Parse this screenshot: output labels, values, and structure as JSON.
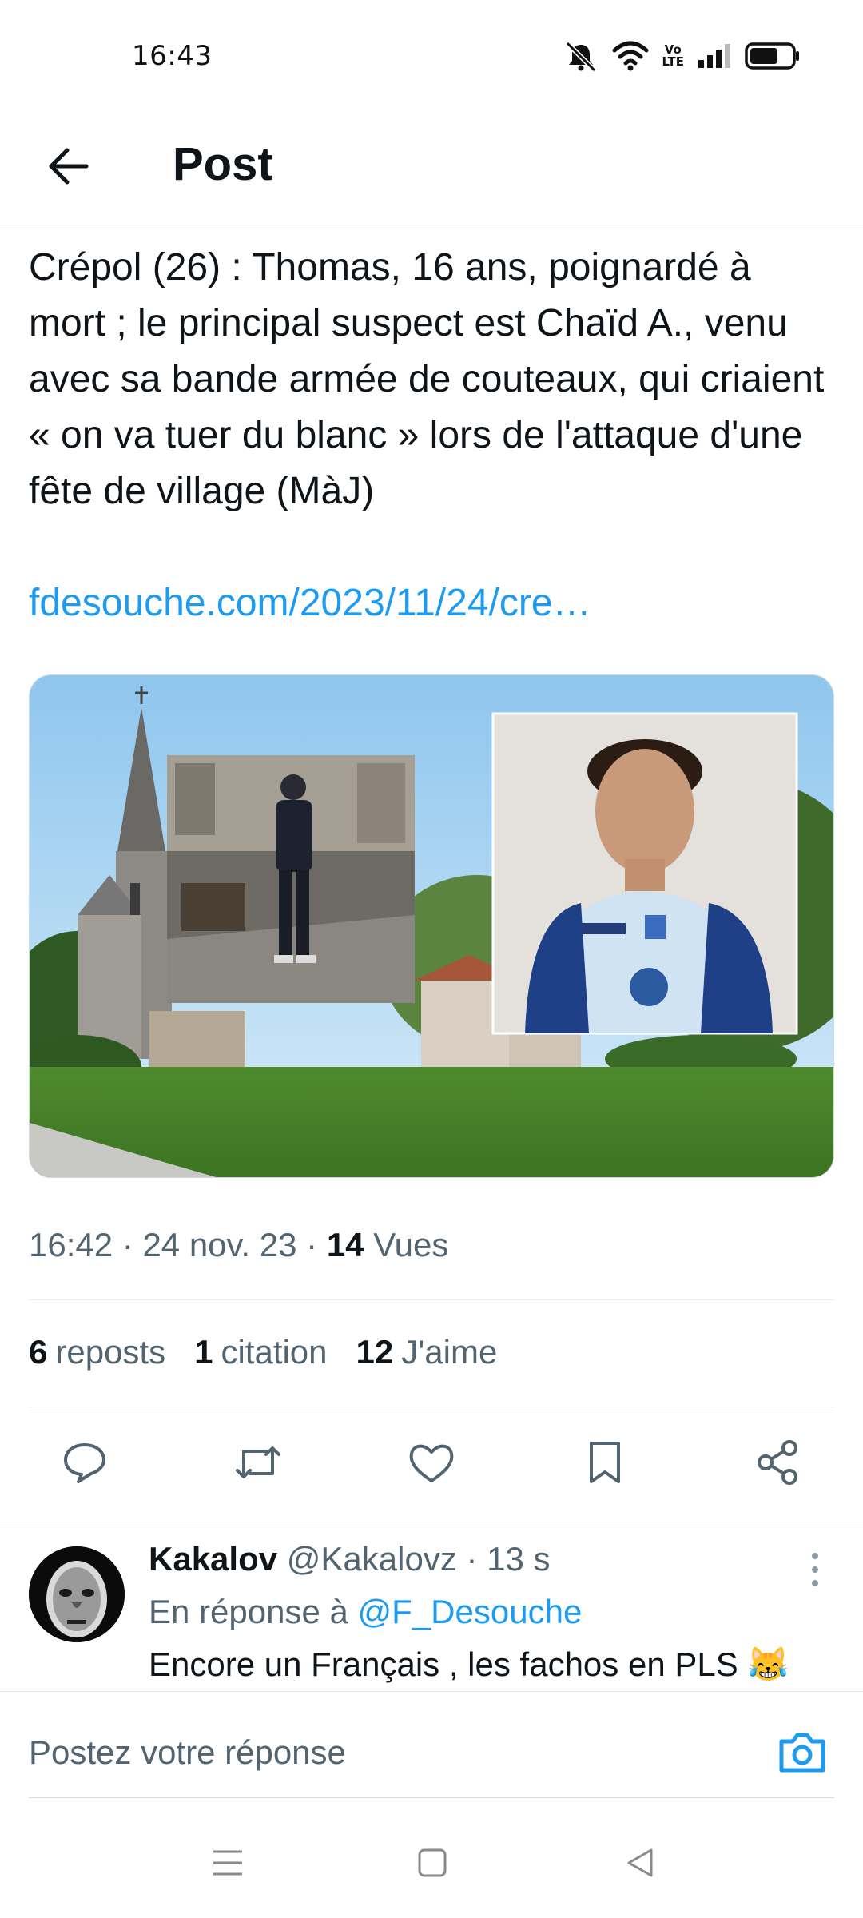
{
  "status_bar": {
    "time": "16:43",
    "icons": [
      "mute-icon",
      "wifi-icon",
      "volte-icon",
      "signal-icon",
      "battery-icon"
    ],
    "volte_top": "Vo",
    "volte_bottom": "LTE"
  },
  "header": {
    "back_icon": "arrow-left-icon",
    "title": "Post"
  },
  "post": {
    "text": "Crépol (26) : Thomas, 16 ans, poignardé à mort ; le principal suspect est Chaïd A., venu avec sa bande armée de couteaux, qui criaient « on va tuer du blanc » lors de l'attaque d'une fête de village (MàJ)",
    "link": "fdesouche.com/2023/11/24/cre…",
    "time": "16:42",
    "date": "24 nov. 23",
    "views_count": "14",
    "views_label": "Vues",
    "reposts_count": "6",
    "reposts_label": "reposts",
    "quotes_count": "1",
    "quotes_label": "citation",
    "likes_count": "12",
    "likes_label": "J'aime"
  },
  "actions": [
    "reply-icon",
    "repost-icon",
    "like-icon",
    "bookmark-icon",
    "share-icon"
  ],
  "reply": {
    "name": "Kakalov",
    "handle": "@Kakalovz",
    "age": "13 s",
    "in_reply_to_label": "En réponse à",
    "in_reply_to_handle": "@F_Desouche",
    "text": "Encore un Français , les fachos en PLS",
    "emoji": "😹"
  },
  "composer": {
    "placeholder": "Postez votre réponse",
    "camera_icon": "camera-icon"
  },
  "navbar": [
    "menu-icon",
    "home-square-icon",
    "back-triangle-icon"
  ],
  "colors": {
    "accent": "#1d9bf0",
    "text": "#0f1419",
    "secondary": "#536471",
    "divider": "#e7e9ea"
  }
}
